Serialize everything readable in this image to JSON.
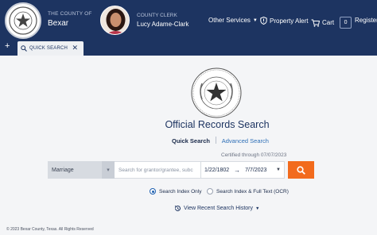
{
  "header": {
    "county_prefix": "THE COUNTY OF",
    "county_name": "Bexar",
    "clerk_title": "COUNTY CLERK",
    "clerk_name": "Lucy Adame-Clark",
    "nav": {
      "other_services": "Other Services",
      "property_alert": "Property Alert",
      "cart": "Cart",
      "cart_count": "0",
      "register": "Register"
    },
    "colors": {
      "brand": "#1d3461",
      "accent": "#f26b1d"
    }
  },
  "tabs": {
    "add_icon": "plus-icon",
    "items": [
      {
        "label": "QUICK SEARCH",
        "icon": "search-icon",
        "close_icon": "close-icon"
      }
    ]
  },
  "main": {
    "title": "Official Records Search",
    "modes": {
      "quick": "Quick Search",
      "advanced": "Advanced Search"
    },
    "certified": "Certified through 07/07/2023",
    "search": {
      "doc_type_selected": "Marriage",
      "grantor_placeholder": "Search for grantor/grantee, subc",
      "date_from": "1/22/1802",
      "date_to": "7/7/2023"
    },
    "options": {
      "index_only": "Search Index Only",
      "full_text": "Search Index & Full Text (OCR)",
      "selected": "index_only"
    },
    "history_link": "View Recent Search History"
  },
  "footer": {
    "copyright": "© 2023 Bexar County, Texas. All Rights Reserved"
  }
}
